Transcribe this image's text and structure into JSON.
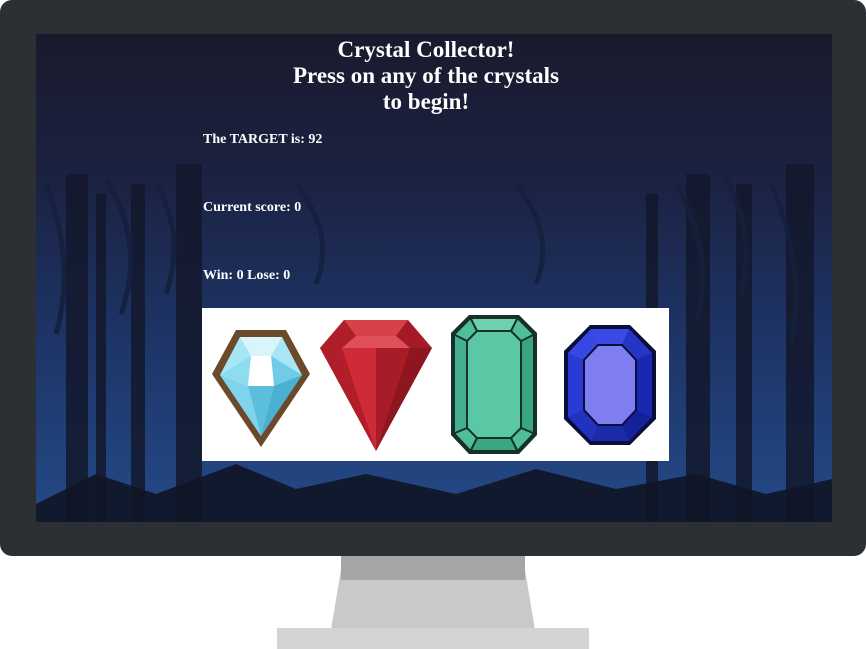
{
  "game": {
    "title_line_1": "Crystal Collector!",
    "title_line_2": "Press on any of the crystals",
    "title_line_3": "to begin!",
    "target_label": "The TARGET is:",
    "target_value": "92",
    "score_label": "Current score:",
    "score_value": "0",
    "win_label": "Win:",
    "win_value": "0",
    "lose_label": "Lose:",
    "lose_value": "0"
  },
  "crystals": [
    {
      "name": "diamond",
      "color": "#7fd6ee"
    },
    {
      "name": "ruby",
      "color": "#c42430"
    },
    {
      "name": "emerald",
      "color": "#4fbf9b"
    },
    {
      "name": "sapphire",
      "color": "#1f2fd0"
    }
  ],
  "colors": {
    "screen_background": "#191a2d",
    "forest_blue": "#1f3f78",
    "bezel": "#2c2f33"
  }
}
